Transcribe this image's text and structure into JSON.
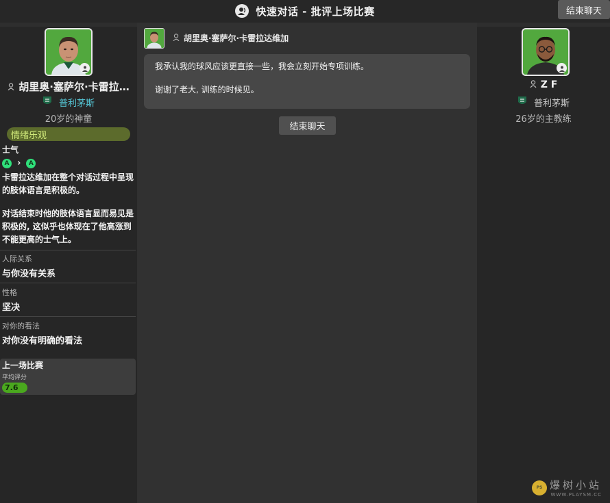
{
  "header": {
    "title": "快速对话 - 批评上场比赛",
    "end_chat_label": "结束聊天"
  },
  "player": {
    "name": "胡里奥·塞萨尔·卡雷拉…",
    "club": "普利茅斯",
    "age_desc": "20岁的神童",
    "mood": "情绪乐观",
    "morale_label": "士气",
    "morale_from": "A",
    "morale_to": "A",
    "body_language_1": "卡雷拉达维加在整个对话过程中呈现的肢体语言是积极的。",
    "body_language_2": "对话结束时他的肢体语言显而易见是积极的, 这似乎也体现在了他高涨到不能更高的士气上。",
    "relationship_label": "人际关系",
    "relationship_value": "与你没有关系",
    "personality_label": "性格",
    "personality_value": "坚决",
    "opinion_label": "对你的看法",
    "opinion_value": "对你没有明确的看法",
    "last_match_title": "上一场比赛",
    "avg_rating_label": "平均评分",
    "avg_rating": "7.6"
  },
  "conversation": {
    "sender": "胡里奥·塞萨尔·卡雷拉达维加",
    "line_1": "我承认我的球风应该更直接一些，我会立刻开始专项训练。",
    "line_2": "谢谢了老大, 训练的时候见。",
    "end_chat_label": "结束聊天"
  },
  "coach": {
    "name": "Z F",
    "club": "普利茅斯",
    "age_desc": "26岁的主教练"
  },
  "watermark": {
    "cn": "爆树小站",
    "url": "WWW.PLAYSM.CC"
  }
}
